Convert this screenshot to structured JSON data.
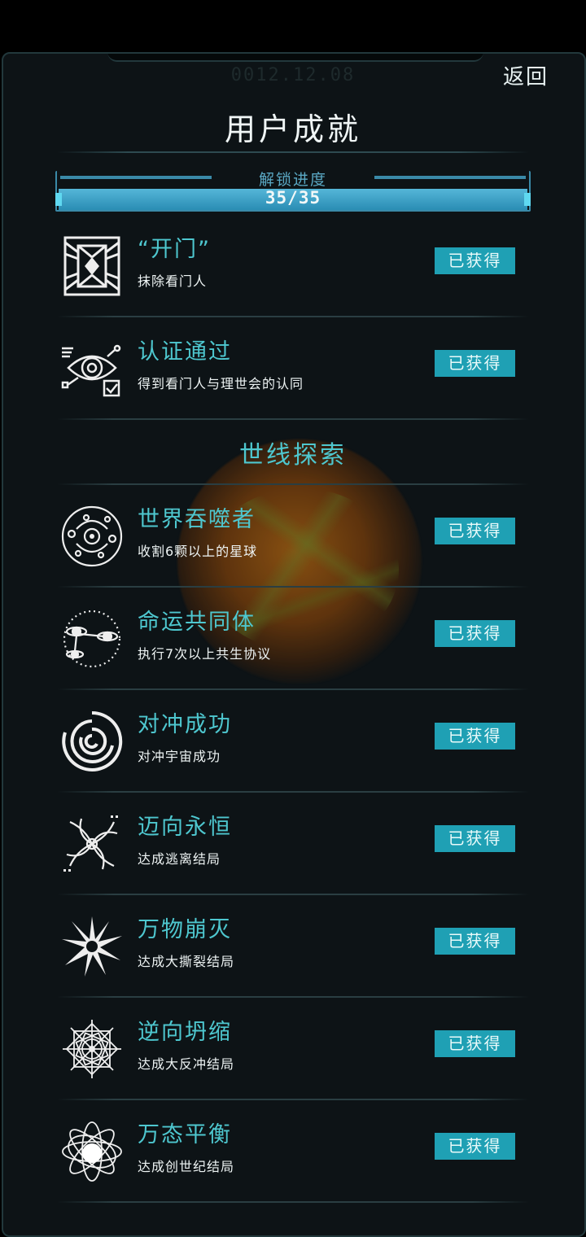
{
  "header": {
    "date": "0012.12.08",
    "back_label": "返回",
    "title": "用户成就"
  },
  "progress": {
    "label": "解锁进度",
    "text": "35/35",
    "fraction": 1.0
  },
  "section_title": "世线探索",
  "achievements_top": [
    {
      "name": "“开门”",
      "desc": "抹除看门人",
      "status": "已获得",
      "icon": "gate-icon"
    },
    {
      "name": "认证通过",
      "desc": "得到看门人与理世会的认同",
      "status": "已获得",
      "icon": "eye-check-icon"
    }
  ],
  "achievements_section": [
    {
      "name": "世界吞噬者",
      "desc": "收割6颗以上的星球",
      "status": "已获得",
      "icon": "orbit-system-icon"
    },
    {
      "name": "命运共同体",
      "desc": "执行7次以上共生协议",
      "status": "已获得",
      "icon": "linked-planets-icon"
    },
    {
      "name": "对冲成功",
      "desc": "对冲宇宙成功",
      "status": "已获得",
      "icon": "swirl-icon"
    },
    {
      "name": "迈向永恒",
      "desc": "达成逃离结局",
      "status": "已获得",
      "icon": "vortex-icon"
    },
    {
      "name": "万物崩灭",
      "desc": "达成大撕裂结局",
      "status": "已获得",
      "icon": "burst-icon"
    },
    {
      "name": "逆向坍缩",
      "desc": "达成大反冲结局",
      "status": "已获得",
      "icon": "mandala-icon"
    },
    {
      "name": "万态平衡",
      "desc": "达成创世纪结局",
      "status": "已获得",
      "icon": "atom-orbit-icon"
    }
  ]
}
